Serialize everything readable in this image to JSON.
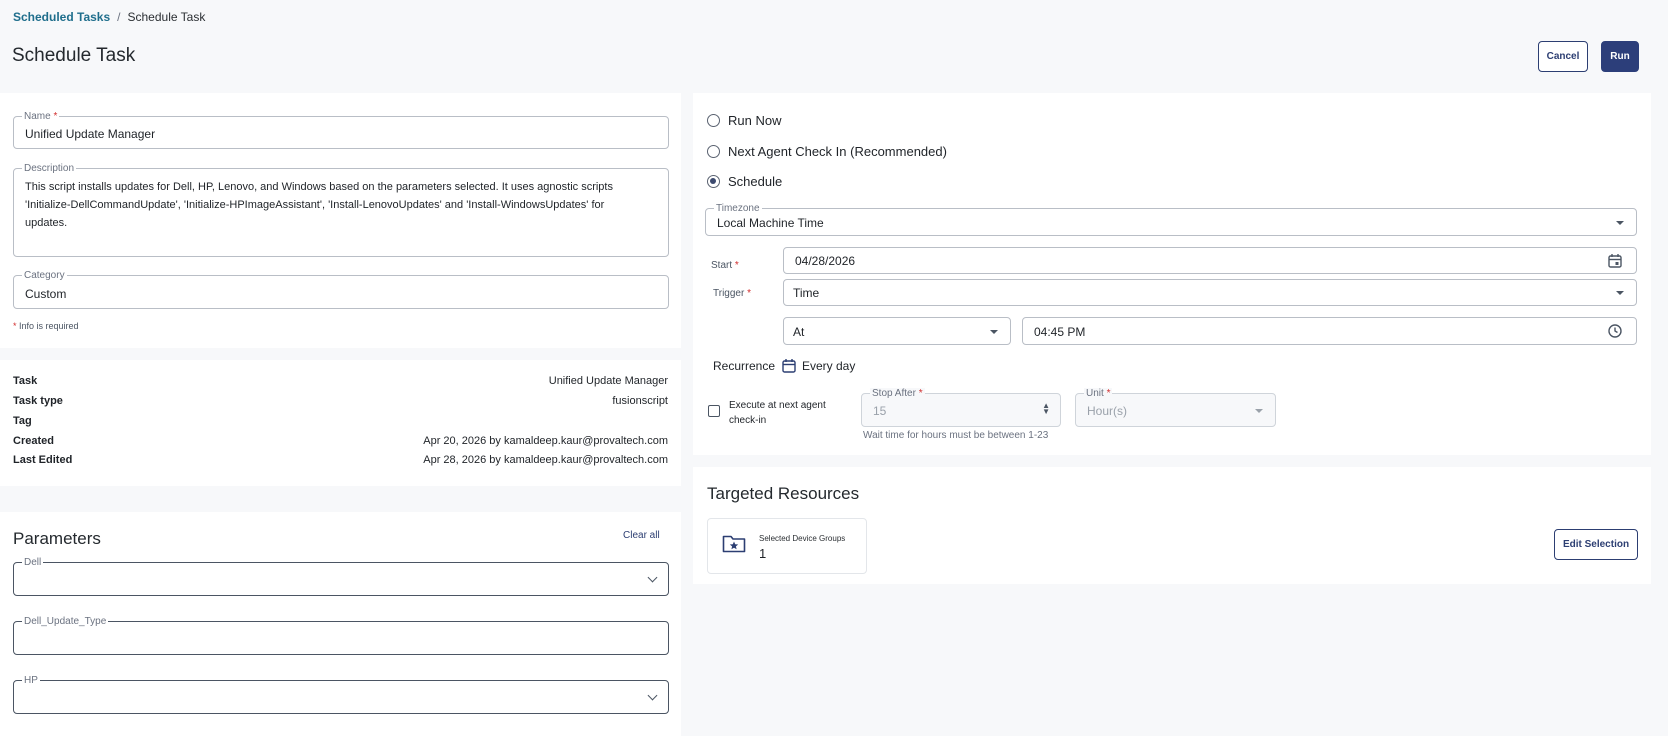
{
  "breadcrumb": {
    "parent": "Scheduled Tasks",
    "separator": "/",
    "current": "Schedule Task"
  },
  "page": {
    "title": "Schedule Task"
  },
  "actions": {
    "cancel_label": "Cancel",
    "run_label": "Run"
  },
  "form": {
    "name_label": "Name",
    "name_value": "Unified Update Manager",
    "description_label": "Description",
    "description_value": "This script installs updates for Dell, HP, Lenovo, and Windows based on the parameters selected. It uses agnostic scripts 'Initialize-DellCommandUpdate', 'Initialize-HPImageAssistant', 'Install-LenovoUpdates' and 'Install-WindowsUpdates' for updates.",
    "category_label": "Category",
    "category_value": "Custom",
    "required_marker": "*",
    "required_note": "Info is required"
  },
  "details": {
    "rows": [
      {
        "key": "Task",
        "value": "Unified Update Manager"
      },
      {
        "key": "Task type",
        "value": "fusionscript"
      },
      {
        "key": "Tag",
        "value": ""
      },
      {
        "key": "Created",
        "value": "Apr 20, 2026 by kamaldeep.kaur@provaltech.com"
      },
      {
        "key": "Last Edited",
        "value": "Apr 28, 2026 by kamaldeep.kaur@provaltech.com"
      }
    ]
  },
  "parameters": {
    "title": "Parameters",
    "clear_all_label": "Clear all",
    "fields": [
      {
        "label": "Dell",
        "value": ""
      },
      {
        "label": "Dell_Update_Type",
        "value": ""
      },
      {
        "label": "HP",
        "value": ""
      }
    ]
  },
  "schedule": {
    "options": [
      {
        "label": "Run Now",
        "selected": false
      },
      {
        "label": "Next Agent Check In (Recommended)",
        "selected": false
      },
      {
        "label": "Schedule",
        "selected": true
      }
    ],
    "timezone_label": "Timezone",
    "timezone_value": "Local Machine Time",
    "start_label": "Start",
    "start_value": "04/28/2026",
    "trigger_label": "Trigger",
    "trigger_value": "Time",
    "at_value": "At",
    "time_value": "04:45 PM",
    "recurrence_label": "Recurrence",
    "recurrence_value": "Every day",
    "execute_label_line1": "Execute at next agent",
    "execute_label_line2": "check-in",
    "stop_after_label": "Stop After",
    "stop_after_value": "15",
    "unit_label": "Unit",
    "unit_value": "Hour(s)",
    "wait_hint": "Wait time for hours must be between 1-23"
  },
  "targets": {
    "title": "Targeted Resources",
    "group_label": "Selected Device Groups",
    "group_count": "1",
    "edit_label": "Edit Selection"
  }
}
